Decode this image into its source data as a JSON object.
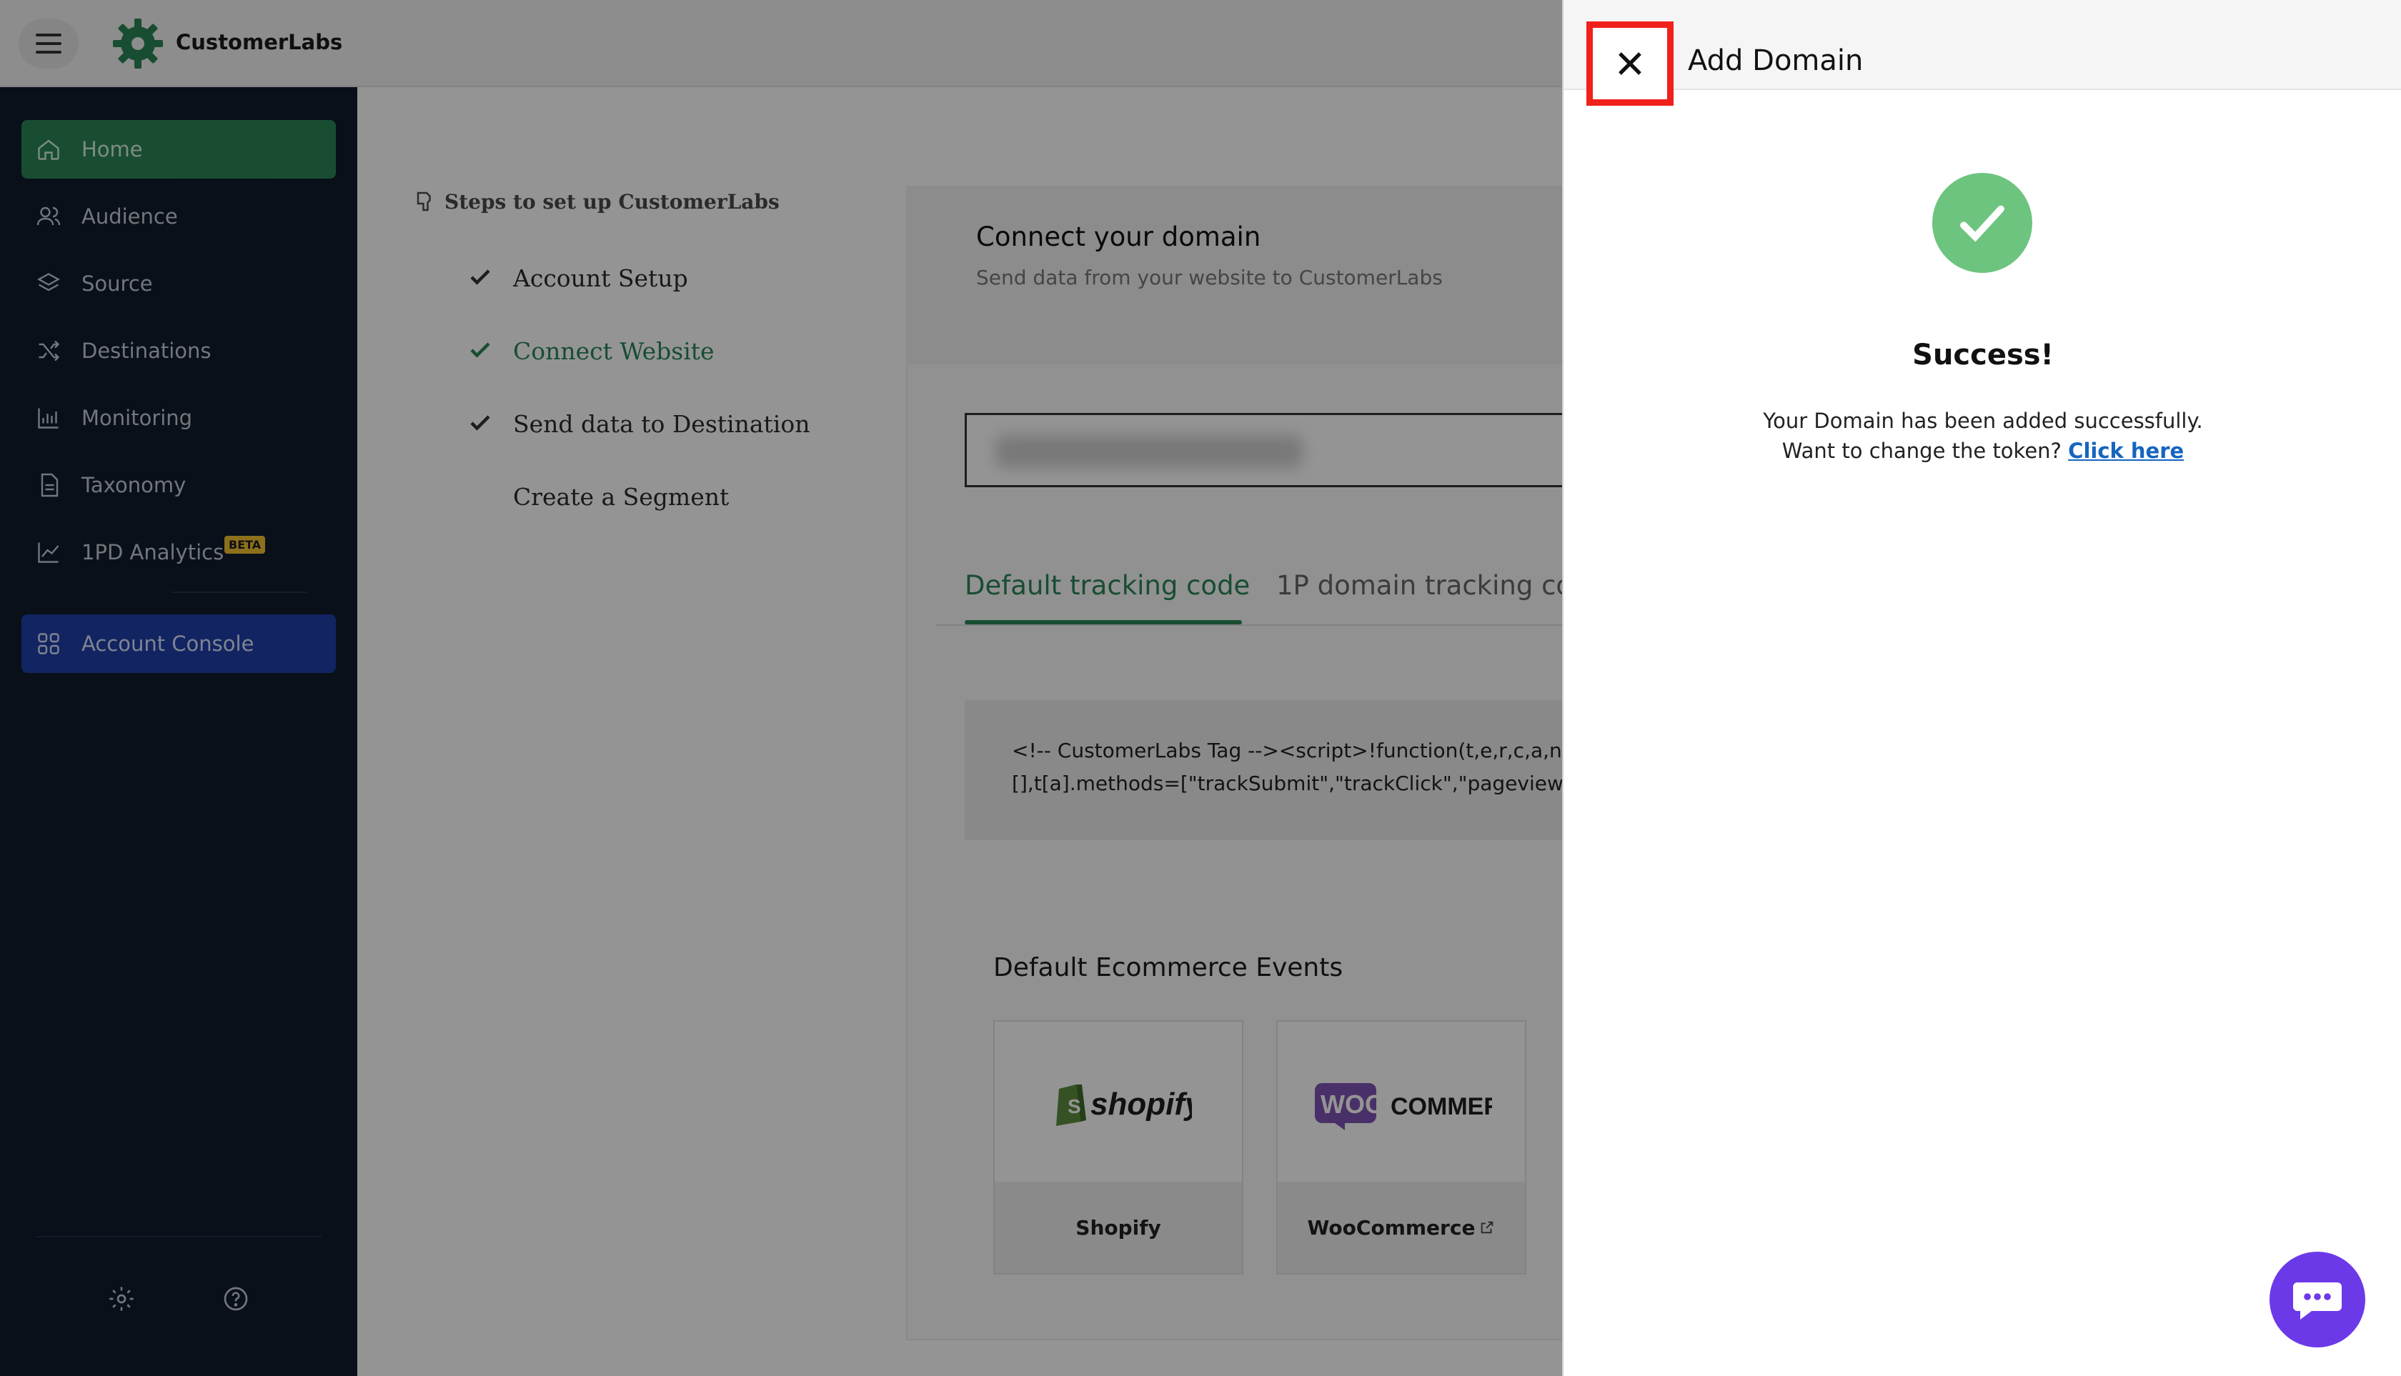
{
  "app": {
    "brand": "CustomerLabs"
  },
  "sidebar": {
    "items": [
      {
        "label": "Home",
        "icon": "home-icon"
      },
      {
        "label": "Audience",
        "icon": "users-icon"
      },
      {
        "label": "Source",
        "icon": "layers-icon"
      },
      {
        "label": "Destinations",
        "icon": "shuffle-icon"
      },
      {
        "label": "Monitoring",
        "icon": "bar-chart-icon"
      },
      {
        "label": "Taxonomy",
        "icon": "document-icon"
      },
      {
        "label": "1PD Analytics",
        "icon": "line-chart-icon",
        "badge": "BETA"
      },
      {
        "label": "Account Console",
        "icon": "grid-icon"
      }
    ],
    "footer_icons": [
      "settings-icon",
      "help-icon"
    ]
  },
  "steps": {
    "title": "Steps to set up CustomerLabs",
    "items": [
      {
        "label": "Account Setup",
        "done": true
      },
      {
        "label": "Connect Website",
        "done": true,
        "current": true
      },
      {
        "label": "Send data to Destination",
        "done": true
      },
      {
        "label": "Create a Segment",
        "done": false
      }
    ]
  },
  "connect": {
    "title": "Connect your domain",
    "subtitle": "Send data from your website to CustomerLabs",
    "tabs": [
      "Default tracking code",
      "1P domain tracking co"
    ],
    "code_lines": [
      "<!-- CustomerLabs Tag --><script>!function(t,e,r,c,a,n,s)",
      "[],t[a].methods=[\"trackSubmit\",\"trackClick\",\"pageview\",\"i"
    ],
    "events_title": "Default Ecommerce Events",
    "platforms": [
      {
        "logo": "shopify",
        "name": "Shopify"
      },
      {
        "logo": "WOO COMMERCE",
        "name": "WooCommerce"
      }
    ]
  },
  "drawer": {
    "title": "Add Domain",
    "success_title": "Success!",
    "message": "Your Domain has been added successfully.",
    "token_prompt": "Want to change the token?",
    "token_link": "Click here"
  },
  "colors": {
    "primary_green": "#2a8556",
    "sidebar_bg": "#111d2e",
    "console_blue": "#1f3ea8",
    "highlight_red": "#f0201a",
    "chat_purple": "#6c39e8",
    "success_green": "#6cc47f"
  }
}
